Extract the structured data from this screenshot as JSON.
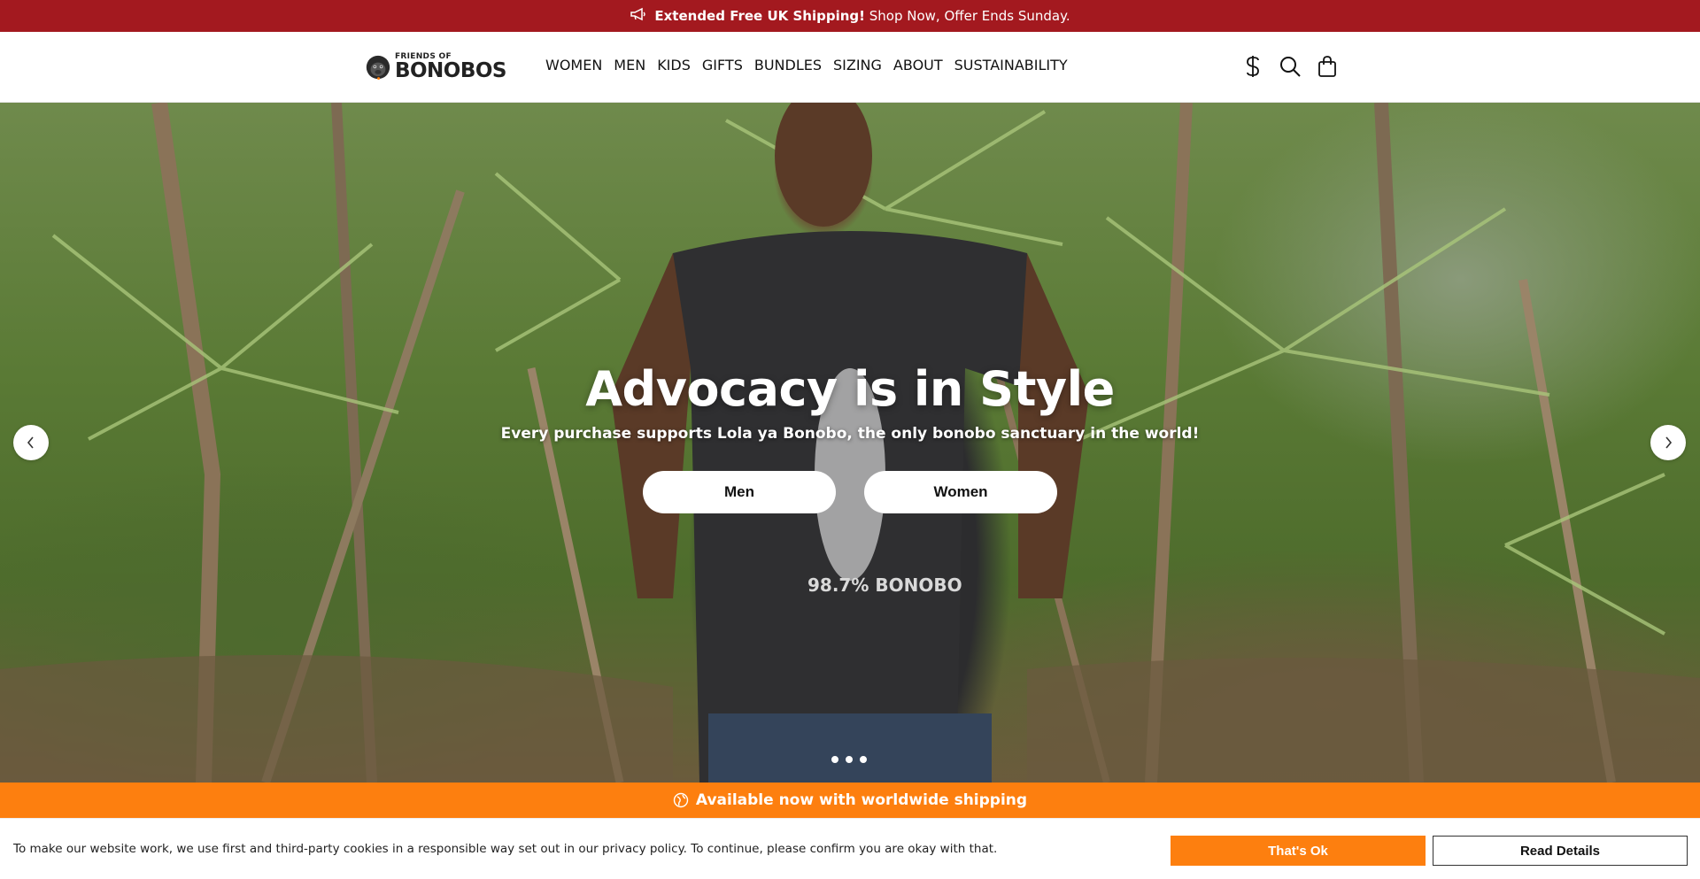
{
  "announcement": {
    "bold": "Extended Free UK Shipping!",
    "rest": "Shop Now, Offer Ends Sunday.",
    "icon": "megaphone-icon"
  },
  "logo": {
    "small": "FRIENDS OF",
    "big": "BONOBOS"
  },
  "nav": [
    "WOMEN",
    "MEN",
    "KIDS",
    "GIFTS",
    "BUNDLES",
    "SIZING",
    "ABOUT",
    "SUSTAINABILITY"
  ],
  "header_icons": [
    "currency-dollar-icon",
    "search-icon",
    "shopping-bag-icon"
  ],
  "hero": {
    "title": "Advocacy is in Style",
    "subtitle": "Every purchase supports Lola ya Bonobo, the only bonobo sanctuary in the world!",
    "buttons": [
      "Men",
      "Women"
    ],
    "slide_count": 3,
    "active_slide": 1,
    "shirt_text": "98.7% BONOBO"
  },
  "shipping_bar": {
    "text": "Available now with worldwide shipping",
    "icon": "globe-icon"
  },
  "cookie": {
    "text": "To make our website work, we use first and third-party cookies in a responsible way set out in our privacy policy. To continue, please confirm you are okay with that.",
    "accept": "That's Ok",
    "details": "Read Details"
  },
  "colors": {
    "announce_bg": "#a3191f",
    "accent_orange": "#fd7f0f"
  }
}
